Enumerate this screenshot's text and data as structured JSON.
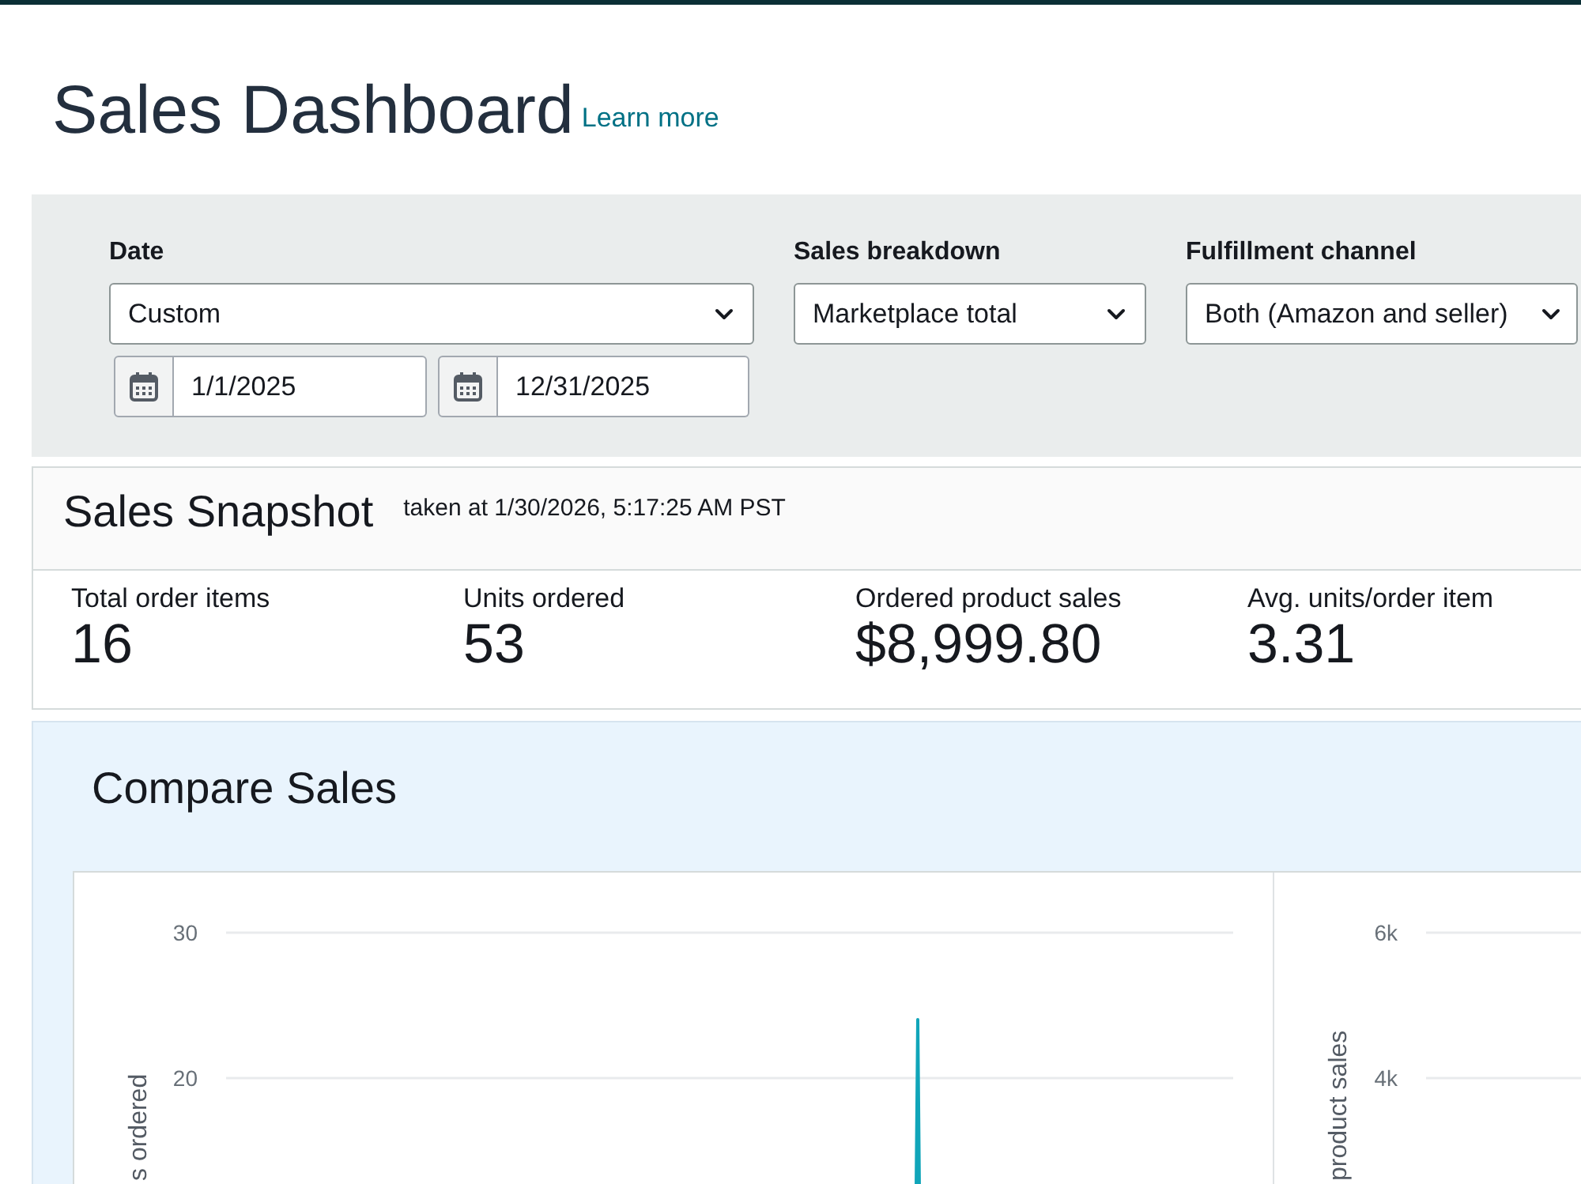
{
  "page": {
    "title": "Sales Dashboard",
    "learn_more_link": "Learn more"
  },
  "filters": {
    "date": {
      "label": "Date",
      "value": "Custom",
      "start_date": "1/1/2025",
      "end_date": "12/31/2025"
    },
    "sales_breakdown": {
      "label": "Sales breakdown",
      "value": "Marketplace total"
    },
    "fulfillment_channel": {
      "label": "Fulfillment channel",
      "value": "Both (Amazon and seller)"
    }
  },
  "snapshot": {
    "title": "Sales Snapshot",
    "timestamp": "taken at 1/30/2026, 5:17:25 AM PST",
    "metrics": [
      {
        "label": "Total order items",
        "value": "16"
      },
      {
        "label": "Units ordered",
        "value": "53"
      },
      {
        "label": "Ordered product sales",
        "value": "$8,999.80"
      },
      {
        "label": "Avg. units/order item",
        "value": "3.31"
      }
    ]
  },
  "compare_sales": {
    "title": "Compare Sales",
    "charts": [
      {
        "y_axis_label": "s ordered",
        "y_tick_labels": [
          "30",
          "20"
        ]
      },
      {
        "y_axis_label": "product sales",
        "y_tick_labels": [
          "6k",
          "4k"
        ]
      }
    ]
  }
}
